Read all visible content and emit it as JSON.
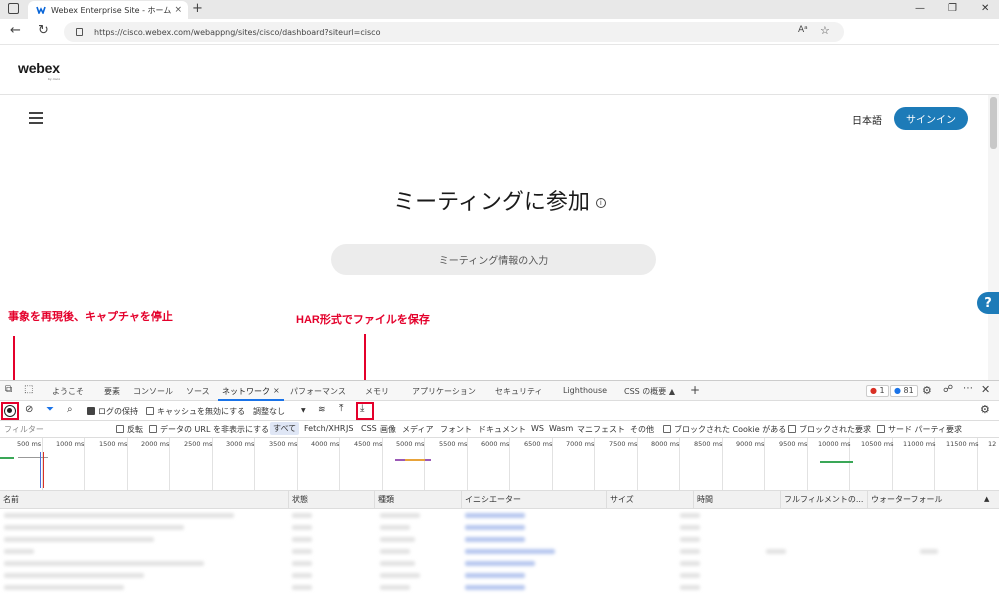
{
  "browser": {
    "tab_title": "Webex Enterprise Site - ホーム",
    "tab_close": "×",
    "new_tab": "+",
    "url": "https://cisco.webex.com/webappng/sites/cisco/dashboard?siteurl=cisco",
    "window_controls": [
      "—",
      "❐",
      "✕"
    ],
    "favicon_color": "#0a66d8"
  },
  "page": {
    "logo": "webex",
    "logo_sub": "by cisco",
    "language": "日本語",
    "signin": "サインイン",
    "title": "ミーティングに参加",
    "title_info": "i",
    "meeting_input_placeholder": "ミーティング情報の入力",
    "help_icon": "?",
    "accent_color": "#1d7bb8"
  },
  "annotations": {
    "left": "事象を再現後、キャプチャを停止",
    "right": "HAR形式でファイルを保存",
    "color": "#e4002b"
  },
  "devtools": {
    "tabs": [
      "ようこそ",
      "要素",
      "コンソール",
      "ソース",
      "ネットワーク",
      "パフォーマンス",
      "メモリ",
      "アプリケーション",
      "セキュリティ",
      "Lighthouse",
      "CSS の概要 ▲"
    ],
    "active_tab": "ネットワーク",
    "add_tab": "+",
    "error_count": "1",
    "message_count": "81",
    "toolbar": {
      "preserve_log": "ログの保持",
      "disable_cache": "キャッシュを無効にする",
      "throttle": "調整なし",
      "throttle_caret": "▼"
    },
    "filter": {
      "placeholder": "フィルター",
      "invert": "反転",
      "hide_data_urls": "データの URL を非表示にする",
      "types": [
        "すべて",
        "Fetch/XHR",
        "JS",
        "CSS",
        "画像",
        "メディア",
        "フォント",
        "ドキュメント",
        "WS",
        "Wasm",
        "マニフェスト",
        "その他"
      ],
      "blocked_cookies": "ブロックされた Cookie がある",
      "blocked_requests": "ブロックされた要求",
      "third_party": "サード パーティ要求"
    },
    "timeline_ticks": [
      "500 ms",
      "1000 ms",
      "1500 ms",
      "2000 ms",
      "2500 ms",
      "3000 ms",
      "3500 ms",
      "4000 ms",
      "4500 ms",
      "5000 ms",
      "5500 ms",
      "6000 ms",
      "6500 ms",
      "7000 ms",
      "7500 ms",
      "8000 ms",
      "8500 ms",
      "9000 ms",
      "9500 ms",
      "10000 ms",
      "10500 ms",
      "11000 ms",
      "11500 ms",
      "12"
    ],
    "columns": [
      "名前",
      "状態",
      "種類",
      "イニシエーター",
      "サイズ",
      "時間",
      "フルフィルメントの...",
      "ウォーターフォール"
    ],
    "sort_indicator": "▲"
  }
}
